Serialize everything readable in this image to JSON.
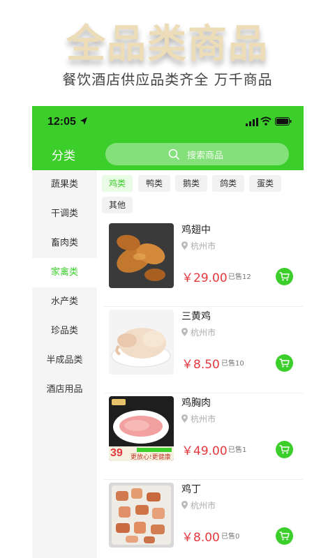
{
  "promo": {
    "title": "全品类商品",
    "subtitle": "餐饮酒店供应品类齐全 万千商品"
  },
  "status_bar": {
    "time": "12:05"
  },
  "nav": {
    "title": "分类",
    "search_placeholder": "搜索商品"
  },
  "sidebar": {
    "items": [
      {
        "label": "蔬果类"
      },
      {
        "label": "干调类"
      },
      {
        "label": "畜肉类"
      },
      {
        "label": "家禽类",
        "active": true
      },
      {
        "label": "水产类"
      },
      {
        "label": "珍品类"
      },
      {
        "label": "半成品类"
      },
      {
        "label": "酒店用品"
      }
    ]
  },
  "tags": [
    {
      "label": "鸡类",
      "active": true
    },
    {
      "label": "鸭类"
    },
    {
      "label": "鹅类"
    },
    {
      "label": "鸽类"
    },
    {
      "label": "蛋类"
    },
    {
      "label": "其他"
    }
  ],
  "products": [
    {
      "name": "鸡翅中",
      "location": "杭州市",
      "price": "￥29.00",
      "sold": "已售12"
    },
    {
      "name": "三黄鸡",
      "location": "杭州市",
      "price": "￥8.50",
      "sold": "已售10"
    },
    {
      "name": "鸡胸肉",
      "location": "杭州市",
      "price": "￥49.00",
      "sold": "已售1"
    },
    {
      "name": "鸡丁",
      "location": "杭州市",
      "price": "￥8.00",
      "sold": "已售0"
    }
  ],
  "image_texts": {
    "chicken_breast_badge": "39",
    "chicken_breast_slogan": "更放心!更健康"
  },
  "colors": {
    "brand_green": "#3ccf2b",
    "price_red": "#e5383d",
    "sidebar_bg": "#f5f5f5"
  },
  "icons": {
    "location_arrow": "location-arrow-icon",
    "signal": "signal-icon",
    "wifi": "wifi-icon",
    "battery": "battery-icon",
    "search": "search-icon",
    "pin": "map-pin-icon",
    "cart": "cart-icon"
  }
}
